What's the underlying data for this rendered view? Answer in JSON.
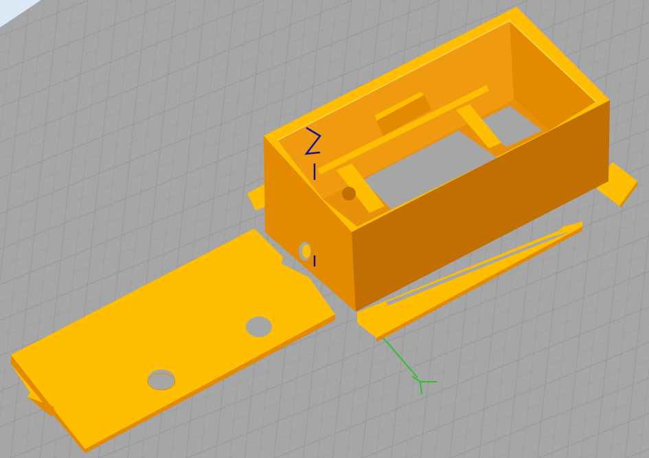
{
  "viewport": {
    "kind": "3d-slicer-build-plate-view",
    "colors": {
      "plate": "#a6a6a6",
      "grid_minor": "#969696",
      "grid_major": "#8a8a8a",
      "sky": "#dbe9f7",
      "part_light": "#ffbf00",
      "part_front": "#e38a00",
      "part_side": "#c06f00",
      "part_inner": "#f09a10",
      "axis_x": "#2fbf2f",
      "axis_z": "#1010a0"
    },
    "objects": [
      "box-enclosure",
      "lid-plate",
      "mounting-frame"
    ],
    "axes": [
      "x-axis",
      "y-axis",
      "z-axis"
    ]
  }
}
